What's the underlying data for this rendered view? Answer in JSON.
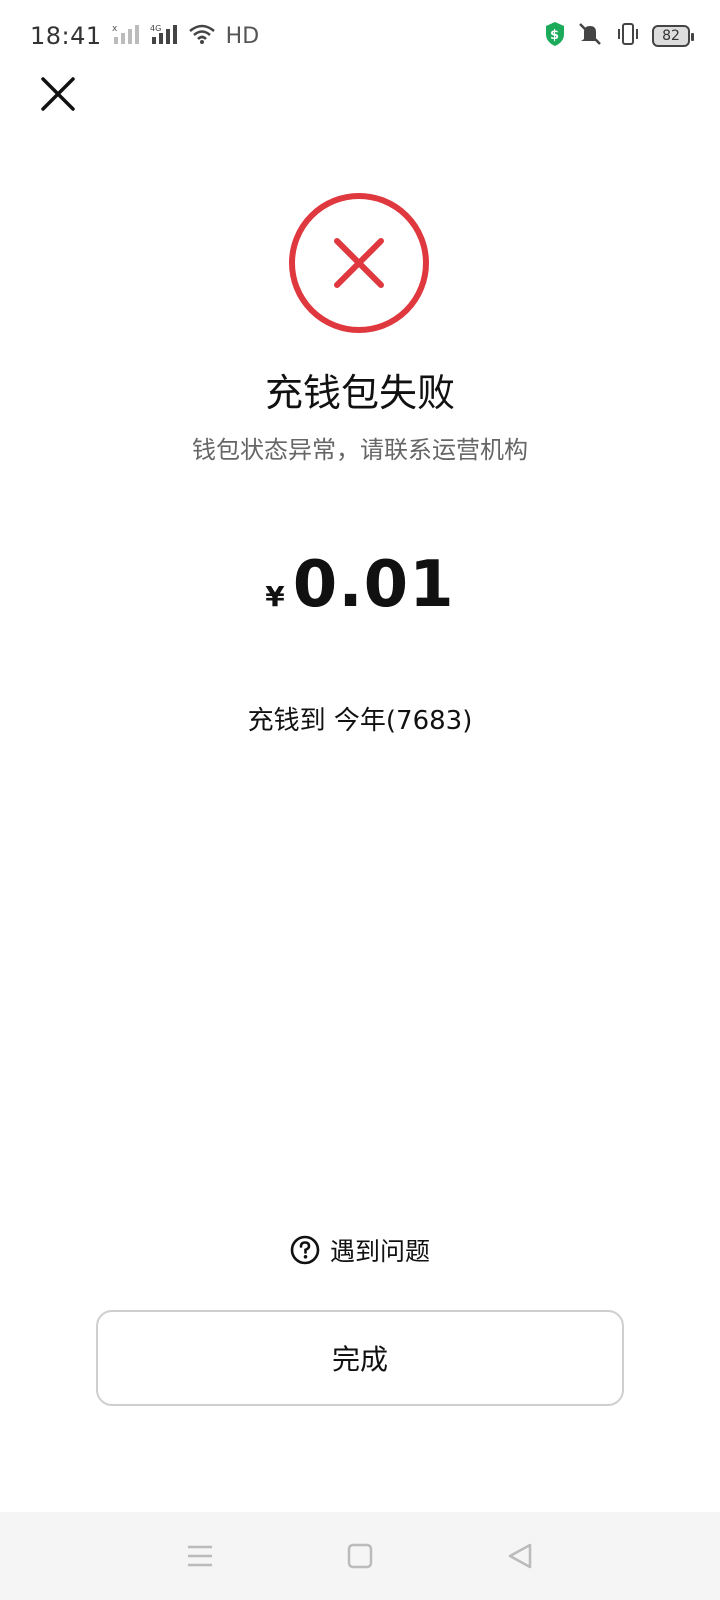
{
  "status_bar": {
    "time": "18:41",
    "network_label": "HD",
    "battery_level": "82"
  },
  "result": {
    "title": "充钱包失败",
    "message": "钱包状态异常，请联系运营机构",
    "status_color": "#e0383f"
  },
  "amount": {
    "currency_symbol": "¥",
    "value": "0.01"
  },
  "target": {
    "label": "充钱到 今年(7683)"
  },
  "help": {
    "label": "遇到问题"
  },
  "actions": {
    "done_label": "完成"
  },
  "icons": {
    "close": "close-icon",
    "fail": "error-x-circle-icon",
    "help": "question-circle-icon"
  }
}
